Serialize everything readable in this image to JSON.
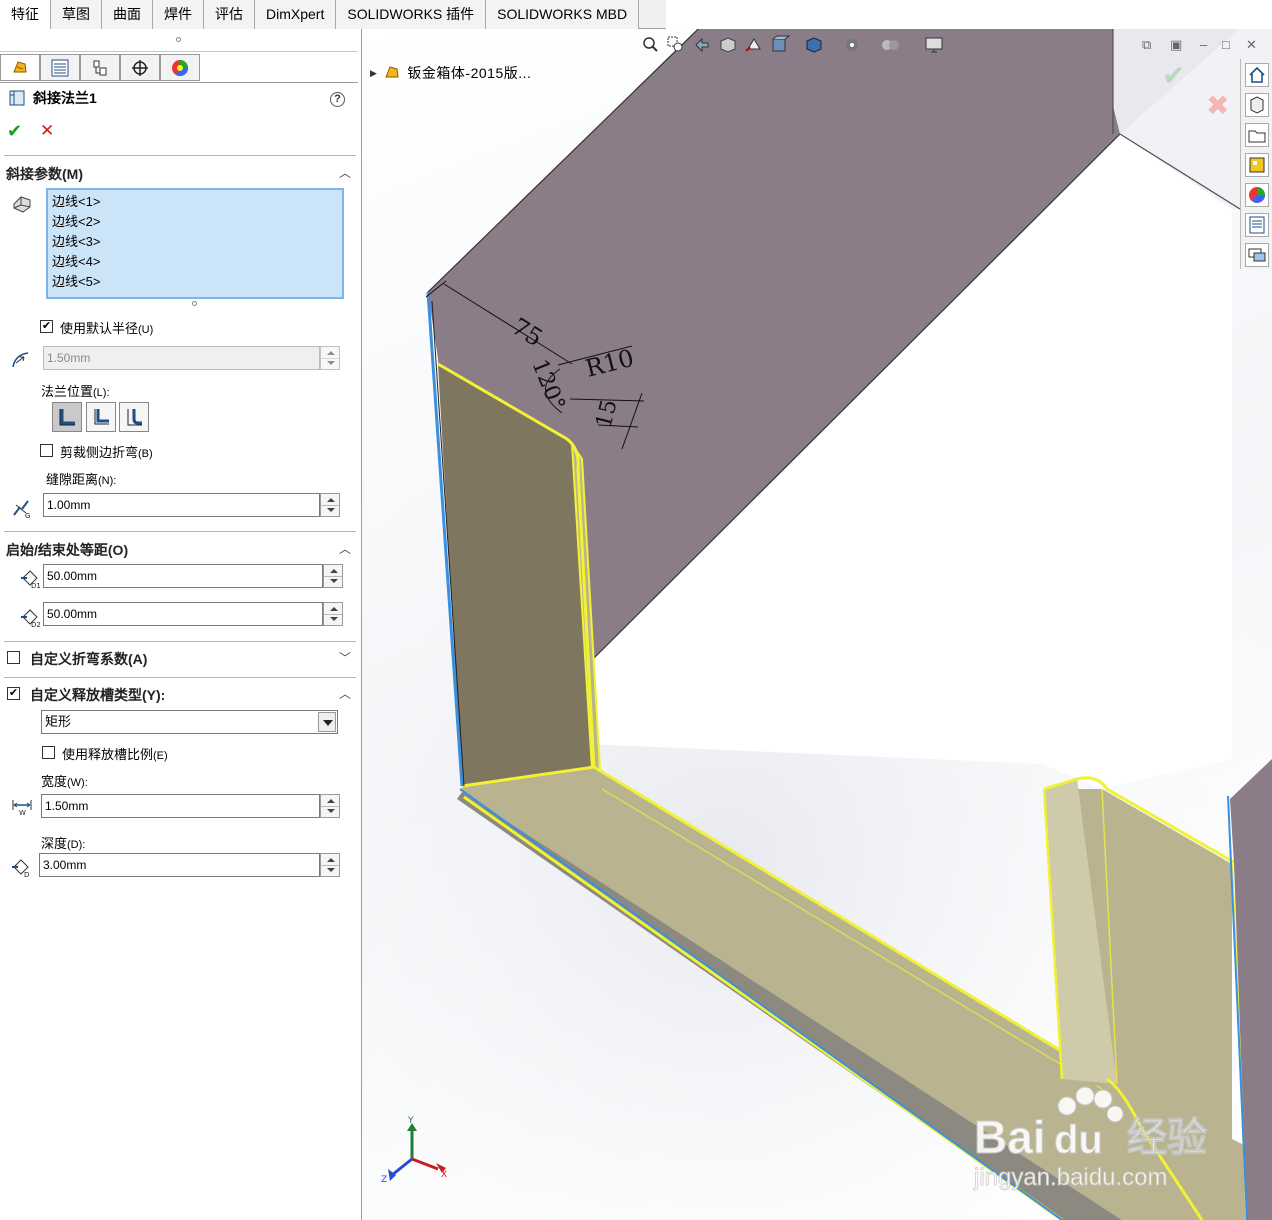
{
  "tabs": [
    "特征",
    "草图",
    "曲面",
    "焊件",
    "评估",
    "DimXpert",
    "SOLIDWORKS 插件",
    "SOLIDWORKS MBD"
  ],
  "property_manager": {
    "title": "斜接法兰1",
    "help": "?",
    "ok": "✔",
    "cancel": "✕",
    "group_miter": {
      "title": "斜接参数(M)",
      "edges": [
        "边线<1>",
        "边线<2>",
        "边线<3>",
        "边线<4>",
        "边线<5>"
      ],
      "use_default_radius": {
        "label": "使用默认半径",
        "key": "(U)",
        "checked": "✔"
      },
      "radius": "1.50mm",
      "flange_position_label": "法兰位置",
      "flange_position_key": "(L):",
      "trim_side_bends": {
        "label": "剪裁侧边折弯",
        "key": "(B)"
      },
      "gap_label": "缝隙距离",
      "gap_key": "(N):",
      "gap": "1.00mm"
    },
    "group_offset": {
      "title": "启始/结束处等距(O)",
      "start": "50.00mm",
      "end": "50.00mm"
    },
    "group_bend": {
      "title": "自定义折弯系数(A)"
    },
    "group_relief": {
      "title": "自定义释放槽类型(Y):",
      "checked": "✔",
      "type": "矩形",
      "use_ratio": {
        "label": "使用释放槽比例",
        "key": "(E)"
      },
      "width_label": "宽度",
      "width_key": "(W):",
      "width": "1.50mm",
      "depth_label": "深度",
      "depth_key": "(D):",
      "depth": "3.00mm"
    }
  },
  "viewport": {
    "tree_item": "钣金箱体-2015版...",
    "dimensions": {
      "d1": "75",
      "d2": "R10",
      "d3": "120°",
      "d4": "15"
    },
    "triad": {
      "x": "X",
      "y": "Y",
      "z": "Z"
    },
    "watermark_main": "Bai",
    "watermark_du": "du",
    "watermark_cn": "经验",
    "watermark_url": "jingyan.baidu.com"
  },
  "colors": {
    "face_dark": "#8b7d88",
    "face_selected": "#7f7660",
    "face_selected_light": "#b9b48f",
    "highlight": "#f2f234",
    "edge_blue": "#3a8fe0"
  }
}
